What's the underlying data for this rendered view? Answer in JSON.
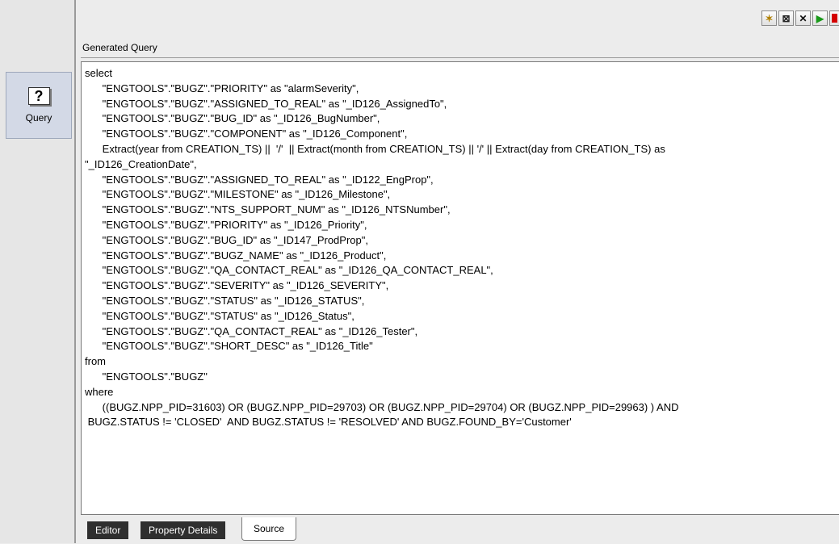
{
  "sidebar": {
    "query_item": {
      "icon_glyph": "?",
      "icon": "help-query-icon",
      "label": "Query"
    }
  },
  "toolbar": {
    "buttons": [
      {
        "name": "new-icon",
        "glyph": "✶"
      },
      {
        "name": "close-panel-icon",
        "glyph": "⊠"
      },
      {
        "name": "delete-x-icon",
        "glyph": "✕"
      },
      {
        "name": "run-icon",
        "glyph": "▶"
      },
      {
        "name": "stop-icon",
        "glyph": ""
      }
    ]
  },
  "panel": {
    "title": "Generated Query",
    "query_text": "select\n      \"ENGTOOLS\".\"BUGZ\".\"PRIORITY\" as \"alarmSeverity\",\n      \"ENGTOOLS\".\"BUGZ\".\"ASSIGNED_TO_REAL\" as \"_ID126_AssignedTo\",\n      \"ENGTOOLS\".\"BUGZ\".\"BUG_ID\" as \"_ID126_BugNumber\",\n      \"ENGTOOLS\".\"BUGZ\".\"COMPONENT\" as \"_ID126_Component\",\n      Extract(year from CREATION_TS) ||  '/'  || Extract(month from CREATION_TS) || '/' || Extract(day from CREATION_TS) as\n\"_ID126_CreationDate\",\n      \"ENGTOOLS\".\"BUGZ\".\"ASSIGNED_TO_REAL\" as \"_ID122_EngProp\",\n      \"ENGTOOLS\".\"BUGZ\".\"MILESTONE\" as \"_ID126_Milestone\",\n      \"ENGTOOLS\".\"BUGZ\".\"NTS_SUPPORT_NUM\" as \"_ID126_NTSNumber\",\n      \"ENGTOOLS\".\"BUGZ\".\"PRIORITY\" as \"_ID126_Priority\",\n      \"ENGTOOLS\".\"BUGZ\".\"BUG_ID\" as \"_ID147_ProdProp\",\n      \"ENGTOOLS\".\"BUGZ\".\"BUGZ_NAME\" as \"_ID126_Product\",\n      \"ENGTOOLS\".\"BUGZ\".\"QA_CONTACT_REAL\" as \"_ID126_QA_CONTACT_REAL\",\n      \"ENGTOOLS\".\"BUGZ\".\"SEVERITY\" as \"_ID126_SEVERITY\",\n      \"ENGTOOLS\".\"BUGZ\".\"STATUS\" as \"_ID126_STATUS\",\n      \"ENGTOOLS\".\"BUGZ\".\"STATUS\" as \"_ID126_Status\",\n      \"ENGTOOLS\".\"BUGZ\".\"QA_CONTACT_REAL\" as \"_ID126_Tester\",\n      \"ENGTOOLS\".\"BUGZ\".\"SHORT_DESC\" as \"_ID126_Title\"\nfrom\n      \"ENGTOOLS\".\"BUGZ\"\nwhere\n      ((BUGZ.NPP_PID=31603) OR (BUGZ.NPP_PID=29703) OR (BUGZ.NPP_PID=29704) OR (BUGZ.NPP_PID=29963) ) AND\n BUGZ.STATUS != 'CLOSED'  AND BUGZ.STATUS != 'RESOLVED' AND BUGZ.FOUND_BY='Customer'"
  },
  "tabs": [
    {
      "label": "Editor",
      "active": false
    },
    {
      "label": "Property Details",
      "active": false
    },
    {
      "label": "Source",
      "active": true
    }
  ],
  "colors": {
    "tab_inactive_bg": "#2f2f2f",
    "tab_active_bg": "#ffffff",
    "run_green": "#1a9a1a",
    "stop_red": "#d40000"
  }
}
